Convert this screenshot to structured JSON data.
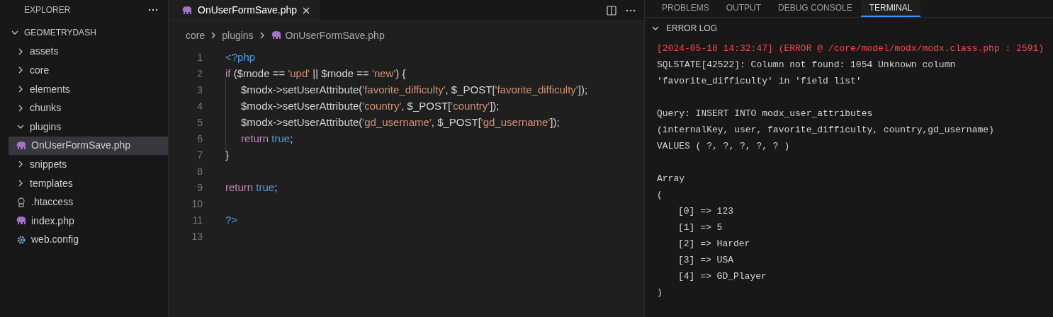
{
  "sidebar": {
    "title": "EXPLORER",
    "tree": [
      {
        "label": "GEOMETRYDASH",
        "kind": "root",
        "expanded": true,
        "selected": false,
        "children": [
          {
            "label": "assets",
            "kind": "folder",
            "expanded": false,
            "selected": false
          },
          {
            "label": "core",
            "kind": "folder",
            "expanded": false,
            "selected": false
          },
          {
            "label": "elements",
            "kind": "folder",
            "expanded": false,
            "selected": false
          },
          {
            "label": "chunks",
            "kind": "folder",
            "expanded": false,
            "selected": false
          },
          {
            "label": "plugins",
            "kind": "folder",
            "expanded": true,
            "selected": false,
            "children": [
              {
                "label": "OnUserFormSave.php",
                "kind": "php",
                "selected": true
              }
            ]
          },
          {
            "label": "snippets",
            "kind": "folder",
            "expanded": false,
            "selected": false
          },
          {
            "label": "templates",
            "kind": "folder",
            "expanded": false,
            "selected": false
          },
          {
            "label": ".htaccess",
            "kind": "htaccess",
            "selected": false
          },
          {
            "label": "index.php",
            "kind": "php",
            "selected": false
          },
          {
            "label": "web.config",
            "kind": "config",
            "selected": false
          }
        ]
      }
    ]
  },
  "editor": {
    "tabs": [
      {
        "label": "OnUserFormSave.php",
        "kind": "php",
        "selected": true
      }
    ],
    "breadcrumbs": [
      {
        "label": "core",
        "kind": "folder"
      },
      {
        "label": "plugins",
        "kind": "folder"
      },
      {
        "label": "OnUserFormSave.php",
        "kind": "php"
      }
    ],
    "lines": [
      {
        "number": "1",
        "indented": false,
        "tokens": [
          {
            "kind": "tag",
            "text": "<?php"
          }
        ]
      },
      {
        "number": "2",
        "indented": false,
        "tokens": [
          {
            "kind": "keyword",
            "text": "if"
          },
          {
            "kind": "plain",
            "text": " ($mode == "
          },
          {
            "kind": "string",
            "text": "'upd'"
          },
          {
            "kind": "plain",
            "text": " || $mode == "
          },
          {
            "kind": "string",
            "text": "'new'"
          },
          {
            "kind": "plain",
            "text": ") {"
          }
        ]
      },
      {
        "number": "3",
        "indented": true,
        "tokens": [
          {
            "kind": "plain",
            "text": "$modx->setUserAttribute("
          },
          {
            "kind": "string",
            "text": "'favorite_difficulty'"
          },
          {
            "kind": "plain",
            "text": ", $_POST["
          },
          {
            "kind": "string",
            "text": "'favorite_difficulty'"
          },
          {
            "kind": "plain",
            "text": "]);"
          }
        ]
      },
      {
        "number": "4",
        "indented": true,
        "tokens": [
          {
            "kind": "plain",
            "text": "$modx->setUserAttribute("
          },
          {
            "kind": "string",
            "text": "'country'"
          },
          {
            "kind": "plain",
            "text": ", $_POST["
          },
          {
            "kind": "string",
            "text": "'country'"
          },
          {
            "kind": "plain",
            "text": "]);"
          }
        ]
      },
      {
        "number": "5",
        "indented": true,
        "tokens": [
          {
            "kind": "plain",
            "text": "$modx->setUserAttribute("
          },
          {
            "kind": "string",
            "text": "'gd_username'"
          },
          {
            "kind": "plain",
            "text": ", $_POST["
          },
          {
            "kind": "string",
            "text": "'gd_username'"
          },
          {
            "kind": "plain",
            "text": "]);"
          }
        ]
      },
      {
        "number": "6",
        "indented": true,
        "tokens": [
          {
            "kind": "keyword",
            "text": "return"
          },
          {
            "kind": "boolean",
            "text": " true"
          },
          {
            "kind": "plain",
            "text": ";"
          }
        ]
      },
      {
        "number": "7",
        "indented": false,
        "tokens": [
          {
            "kind": "plain",
            "text": "}"
          }
        ]
      },
      {
        "number": "8",
        "indented": false
      },
      {
        "number": "9",
        "indented": false,
        "tokens": [
          {
            "kind": "keyword",
            "text": "return"
          },
          {
            "kind": "boolean",
            "text": " true"
          },
          {
            "kind": "plain",
            "text": ";"
          }
        ]
      },
      {
        "number": "10",
        "indented": false
      },
      {
        "number": "11",
        "indented": false,
        "tokens": [
          {
            "kind": "tag",
            "text": "?>"
          }
        ]
      },
      {
        "number": "13",
        "indented": false
      }
    ]
  },
  "panel": {
    "tabs": [
      {
        "label": "PROBLEMS",
        "selected": false
      },
      {
        "label": "OUTPUT",
        "selected": false
      },
      {
        "label": "DEBUG CONSOLE",
        "selected": false
      },
      {
        "label": "TERMINAL",
        "selected": true
      }
    ],
    "section": {
      "title": "ERROR LOG",
      "expanded": true
    },
    "blocks": [
      [
        {
          "kind": "error",
          "text": "[2024-05-18 14:32:47] (ERROR @ /core/model/modx/modx.class.php : 2591)"
        },
        {
          "kind": "plain",
          "text": "SQLSTATE[42522]: Column not found: 1054 Unknown column"
        },
        {
          "kind": "plain",
          "text": "'favorite_difficulty' in 'field list'"
        }
      ],
      [
        {
          "kind": "plain",
          "text": "Query: INSERT INTO modx_user_attributes"
        },
        {
          "kind": "plain",
          "text": "(internalKey, user, favorite_difficulty, country,gd_username)"
        },
        {
          "kind": "plain",
          "text": "VALUES ( ?, ?, ?, ?, ? )"
        }
      ],
      [
        {
          "kind": "plain",
          "text": "Array"
        },
        {
          "kind": "plain",
          "text": "("
        },
        {
          "kind": "indented",
          "text": "[0] => 123"
        },
        {
          "kind": "indented",
          "text": "[1] => 5"
        },
        {
          "kind": "indented",
          "text": "[2] => Harder"
        },
        {
          "kind": "indented",
          "text": "[3] => USA"
        },
        {
          "kind": "indented",
          "text": "[4] => GD_Player"
        },
        {
          "kind": "plain",
          "text": ")"
        }
      ]
    ]
  }
}
